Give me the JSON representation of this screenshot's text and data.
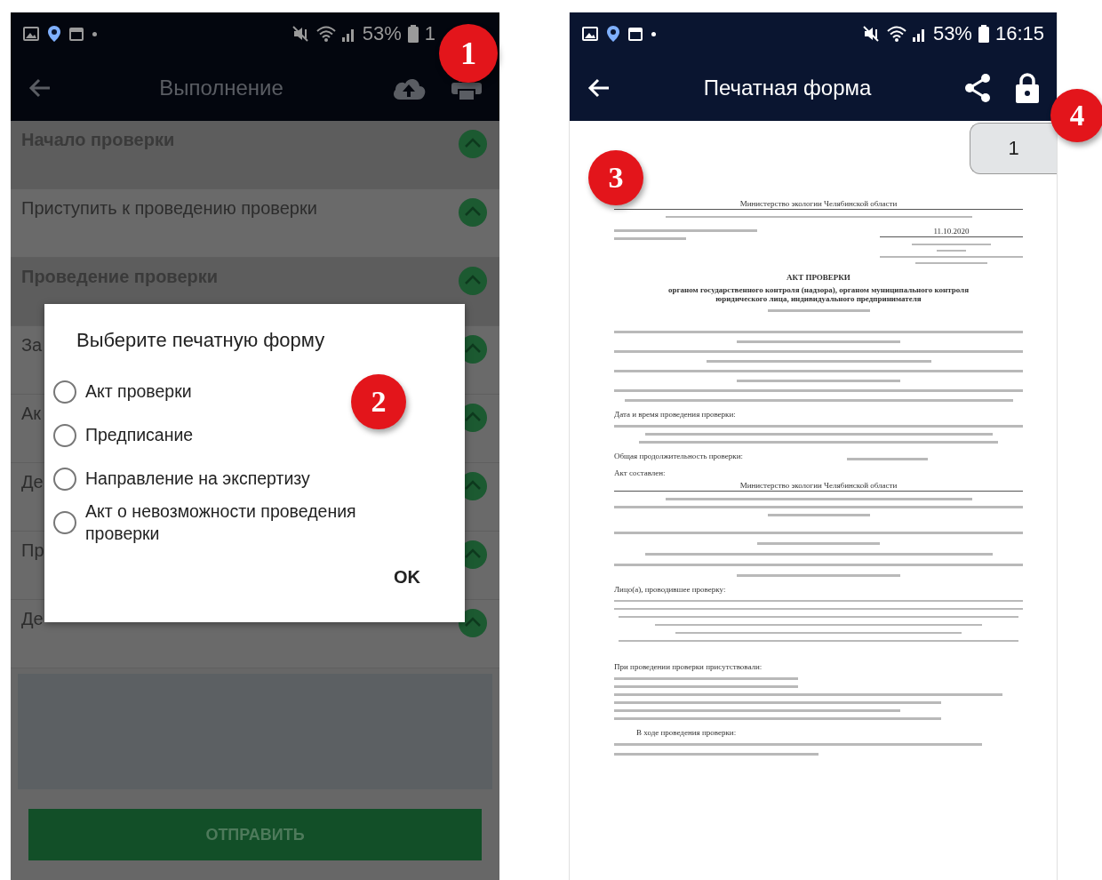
{
  "left_screen": {
    "status_bar": {
      "battery": "53%",
      "time": "1"
    },
    "app_bar": {
      "title": "Выполнение"
    },
    "steps": [
      {
        "label": "Начало проверки",
        "kind": "section"
      },
      {
        "label": "Приступить к проведению проверки",
        "kind": "item"
      },
      {
        "label": "Проведение проверки",
        "kind": "section"
      },
      {
        "label": "За",
        "kind": "item"
      },
      {
        "label": "Ак",
        "kind": "item"
      },
      {
        "label": "Де",
        "kind": "item"
      },
      {
        "label": "Пр",
        "kind": "item"
      },
      {
        "label": "Де",
        "kind": "item"
      }
    ],
    "dialog": {
      "title": "Выберите печатную форму",
      "options": [
        {
          "label": "Акт проверки",
          "selected": false
        },
        {
          "label": "Предписание",
          "selected": false
        },
        {
          "label": "Направление на экспертизу",
          "selected": false
        },
        {
          "label": "Акт о невозможности проведения проверки",
          "selected": false
        }
      ],
      "ok_button": "OK"
    },
    "submit_button": "ОТПРАВИТЬ"
  },
  "right_screen": {
    "status_bar": {
      "battery": "53%",
      "time": "16:15"
    },
    "app_bar": {
      "title": "Печатная форма"
    },
    "page_number": "1",
    "document": {
      "authority": "Министерство экологии Челябинской области",
      "date": "11.10.2020",
      "title": "АКТ ПРОВЕРКИ",
      "subtitle": "органом государственного контроля (надзора), органом муниципального контроля юридического лица, индивидуального предпринимателя",
      "date_label": "Дата и время проведения проверки:",
      "duration_label": "Общая продолжительность проверки:",
      "compiled_label": "Акт составлен:",
      "compiled_by": "Министерство экологии Челябинской области",
      "inspectors_label": "Лицо(а), проводившее проверку:",
      "present_label": "При проведении проверки присутствовали:",
      "findings_label": "В ходе проведения проверки:"
    }
  },
  "callouts": [
    "1",
    "2",
    "3",
    "4"
  ]
}
